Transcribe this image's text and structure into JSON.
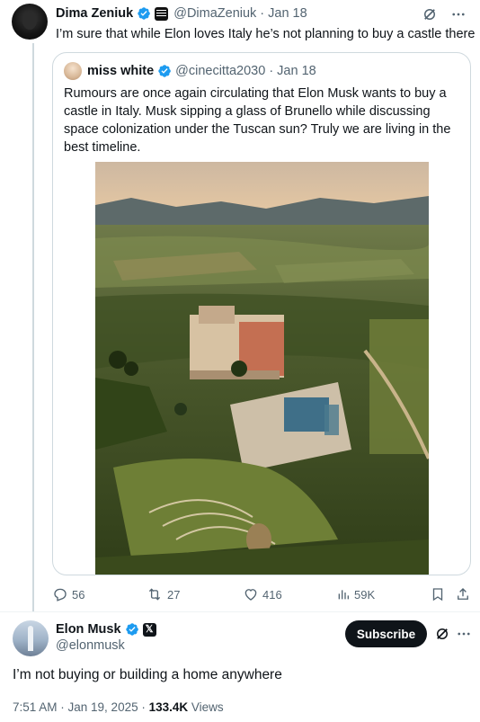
{
  "tweet1": {
    "author_name": "Dima Zeniuk",
    "handle": "@DimaZeniuk",
    "date": "· Jan 18",
    "text": "I’m sure that while Elon loves Italy he’s not planning to buy a castle there",
    "quote": {
      "author_name": "miss white",
      "handle": "@cinecitta2030",
      "date": "· Jan 18",
      "text": "Rumours are once again circulating that Elon Musk wants to buy a castle in Italy. Musk sipping a glass of Brunello while discussing space colonization under the Tuscan sun? Truly we are living in the best timeline."
    },
    "actions": {
      "replies": "56",
      "reposts": "27",
      "likes": "416",
      "views": "59K"
    }
  },
  "tweet2": {
    "author_name": "Elon Musk",
    "handle": "@elonmusk",
    "subscribe_label": "Subscribe",
    "text": "I’m not buying or building a home anywhere",
    "time_date": "7:51 AM · Jan 19, 2025 · ",
    "views_count": "133.4K",
    "views_label": " Views"
  },
  "colors": {
    "verified_blue": "#1d9bf0",
    "muted_text": "#536471",
    "border": "#cfd9de",
    "text": "#0f1419"
  },
  "icons": [
    "verified-icon",
    "affiliate-badge-icon",
    "grok-icon",
    "more-icon",
    "reply-icon",
    "repost-icon",
    "like-icon",
    "views-icon",
    "bookmark-icon",
    "share-icon",
    "x-logo-icon"
  ]
}
